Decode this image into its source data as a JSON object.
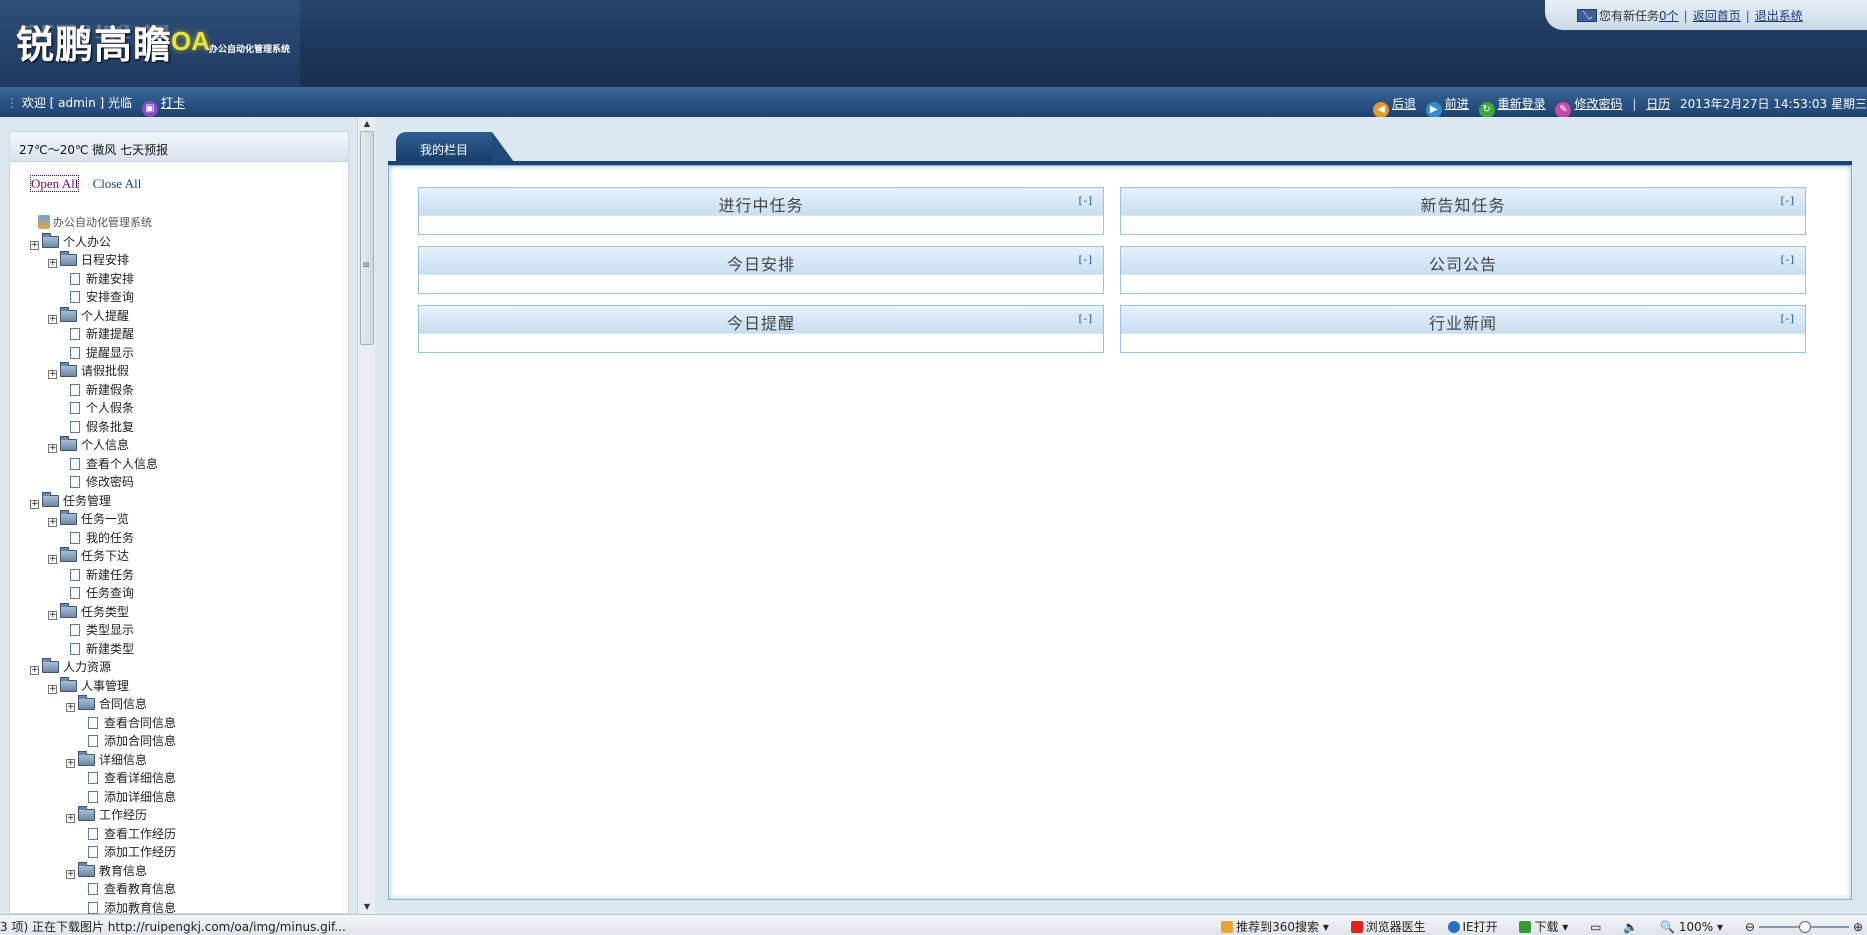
{
  "header": {
    "logo_text": "锐鹏高瞻",
    "logo_oa": "OA",
    "logo_subtitle": "办公自动化管理系统",
    "new_task_prefix": "您有新任务",
    "new_task_count": "0个",
    "home_link": "返回首页",
    "exit_link": "退出系统"
  },
  "toolbar": {
    "welcome": "欢迎 [ admin ] 光临",
    "punch_card": "打卡",
    "back": "后退",
    "forward": "前进",
    "relogin": "重新登录",
    "change_password": "修改密码",
    "calendar": "日历",
    "datetime": "2013年2月27日 14:53:03 星期三"
  },
  "sidebar": {
    "weather": "27℃～20℃  微风  七天预报",
    "open_all": "Open All",
    "close_all": "Close All",
    "root": "办公自动化管理系统",
    "tree": [
      {
        "level": 0,
        "type": "folder",
        "label": "个人办公"
      },
      {
        "level": 1,
        "type": "folder",
        "label": "日程安排"
      },
      {
        "level": 2,
        "type": "page",
        "label": "新建安排"
      },
      {
        "level": 2,
        "type": "page",
        "label": "安排查询"
      },
      {
        "level": 1,
        "type": "folder",
        "label": "个人提醒"
      },
      {
        "level": 2,
        "type": "page",
        "label": "新建提醒"
      },
      {
        "level": 2,
        "type": "page",
        "label": "提醒显示"
      },
      {
        "level": 1,
        "type": "folder",
        "label": "请假批假"
      },
      {
        "level": 2,
        "type": "page",
        "label": "新建假条"
      },
      {
        "level": 2,
        "type": "page",
        "label": "个人假条"
      },
      {
        "level": 2,
        "type": "page",
        "label": "假条批复"
      },
      {
        "level": 1,
        "type": "folder",
        "label": "个人信息"
      },
      {
        "level": 2,
        "type": "page",
        "label": "查看个人信息"
      },
      {
        "level": 2,
        "type": "page",
        "label": "修改密码"
      },
      {
        "level": 0,
        "type": "folder",
        "label": "任务管理"
      },
      {
        "level": 1,
        "type": "folder",
        "label": "任务一览"
      },
      {
        "level": 2,
        "type": "page",
        "label": "我的任务"
      },
      {
        "level": 1,
        "type": "folder",
        "label": "任务下达"
      },
      {
        "level": 2,
        "type": "page",
        "label": "新建任务"
      },
      {
        "level": 2,
        "type": "page",
        "label": "任务查询"
      },
      {
        "level": 1,
        "type": "folder",
        "label": "任务类型"
      },
      {
        "level": 2,
        "type": "page",
        "label": "类型显示"
      },
      {
        "level": 2,
        "type": "page",
        "label": "新建类型"
      },
      {
        "level": 0,
        "type": "folder",
        "label": "人力资源"
      },
      {
        "level": 1,
        "type": "folder",
        "label": "人事管理"
      },
      {
        "level": 2,
        "type": "folder",
        "label": "合同信息"
      },
      {
        "level": 3,
        "type": "page",
        "label": "查看合同信息"
      },
      {
        "level": 3,
        "type": "page",
        "label": "添加合同信息"
      },
      {
        "level": 2,
        "type": "folder",
        "label": "详细信息"
      },
      {
        "level": 3,
        "type": "page",
        "label": "查看详细信息"
      },
      {
        "level": 3,
        "type": "page",
        "label": "添加详细信息"
      },
      {
        "level": 2,
        "type": "folder",
        "label": "工作经历"
      },
      {
        "level": 3,
        "type": "page",
        "label": "查看工作经历"
      },
      {
        "level": 3,
        "type": "page",
        "label": "添加工作经历"
      },
      {
        "level": 2,
        "type": "folder",
        "label": "教育信息"
      },
      {
        "level": 3,
        "type": "page",
        "label": "查看教育信息"
      },
      {
        "level": 3,
        "type": "page",
        "label": "添加教育信息"
      }
    ]
  },
  "main": {
    "tab_label": "我的栏目",
    "toggle": "[-]",
    "boxes": [
      {
        "title": "进行中任务"
      },
      {
        "title": "新告知任务"
      },
      {
        "title": "今日安排"
      },
      {
        "title": "公司公告"
      },
      {
        "title": "今日提醒"
      },
      {
        "title": "行业新闻"
      }
    ]
  },
  "statusbar": {
    "status_text": "3 项) 正在下载图片 http://ruipengkj.com/oa/img/minus.gif...",
    "recommend": "推荐到360搜索",
    "doctor": "浏览器医生",
    "ie_open": "IE打开",
    "download": "下载",
    "zoom": "100%"
  }
}
